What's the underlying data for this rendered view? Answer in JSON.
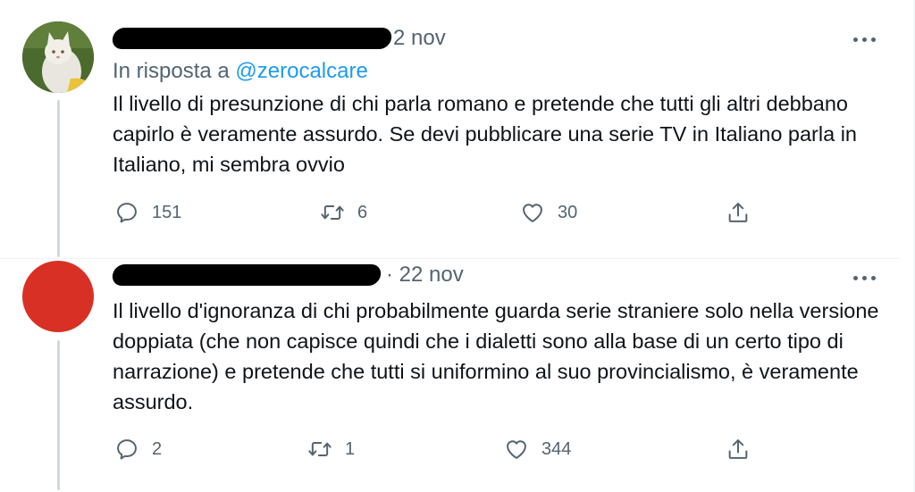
{
  "tweets": [
    {
      "date": "2 nov",
      "reply_prefix": "In risposta a",
      "reply_handle": "@zerocalcare",
      "text": "Il livello di presunzione di chi parla romano e pretende che tutti gli altri debbano capirlo è veramente assurdo. Se devi pubblicare una serie TV in Italiano parla in Italiano, mi sembra ovvio",
      "replies": "151",
      "retweets": "6",
      "likes": "30",
      "avatar_icon": "cat-photo"
    },
    {
      "date": "· 22 nov",
      "text": "Il livello d'ignoranza di chi probabilmente guarda serie straniere solo nella versione doppiata (che non capisce quindi che i dialetti sono alla base di un certo tipo di narrazione) e pretende che tutti si uniformino al suo provincialismo, è veramente assurdo.",
      "replies": "2",
      "retweets": "1",
      "likes": "344",
      "avatar_color": "#d93025"
    }
  ],
  "icons": {
    "more": "more-horizontal-icon",
    "reply": "reply-icon",
    "retweet": "retweet-icon",
    "like": "heart-icon",
    "share": "share-icon"
  },
  "colors": {
    "link": "#1d9bf0",
    "muted": "#536471",
    "text": "#0f1419",
    "thread_line": "#cfd9de"
  }
}
